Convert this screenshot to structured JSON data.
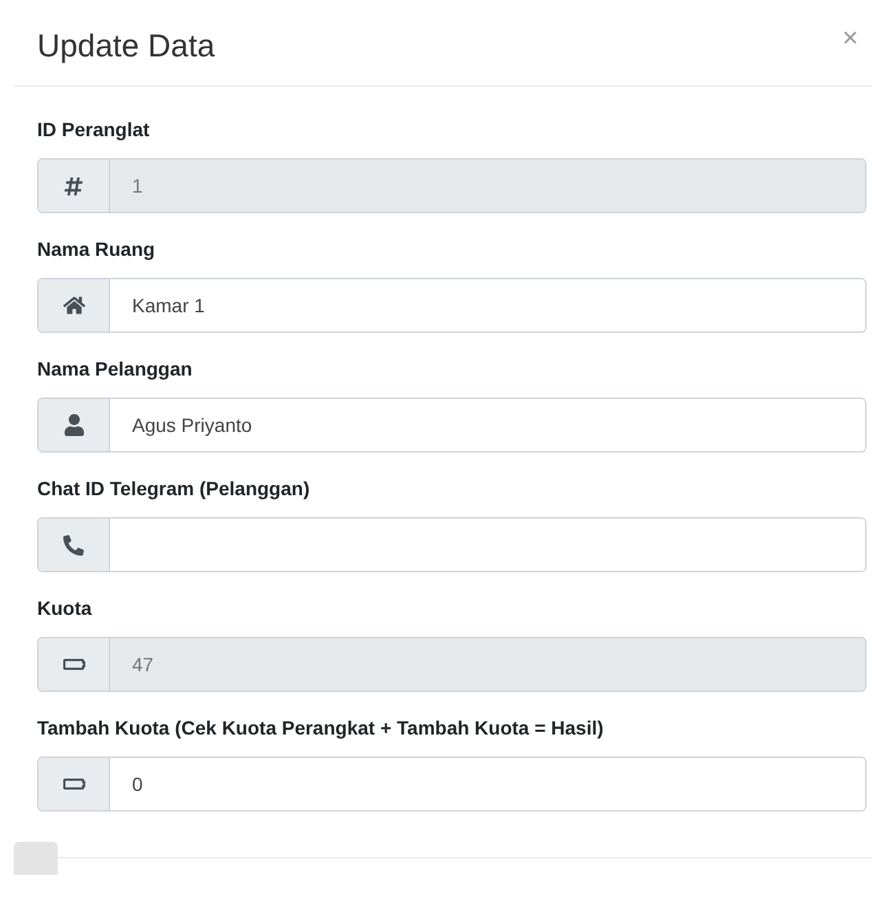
{
  "modal": {
    "title": "Update Data",
    "close": "×"
  },
  "fields": [
    {
      "label": "ID Peranglat",
      "kind": "hash",
      "value": "1",
      "disabled": true
    },
    {
      "label": "Nama Ruang",
      "kind": "home",
      "value": "Kamar 1",
      "disabled": false
    },
    {
      "label": "Nama Pelanggan",
      "kind": "user",
      "value": "Agus Priyanto",
      "disabled": false
    },
    {
      "label": "Chat ID Telegram (Pelanggan)",
      "kind": "phone",
      "disabled": false
    },
    {
      "label": "Kuota",
      "kind": "battery",
      "value": "47",
      "disabled": true
    },
    {
      "label": "Tambah Kuota (Cek Kuota Perangkat + Tambah Kuota = Hasil)",
      "kind": "battery",
      "value": "0",
      "disabled": false
    }
  ]
}
